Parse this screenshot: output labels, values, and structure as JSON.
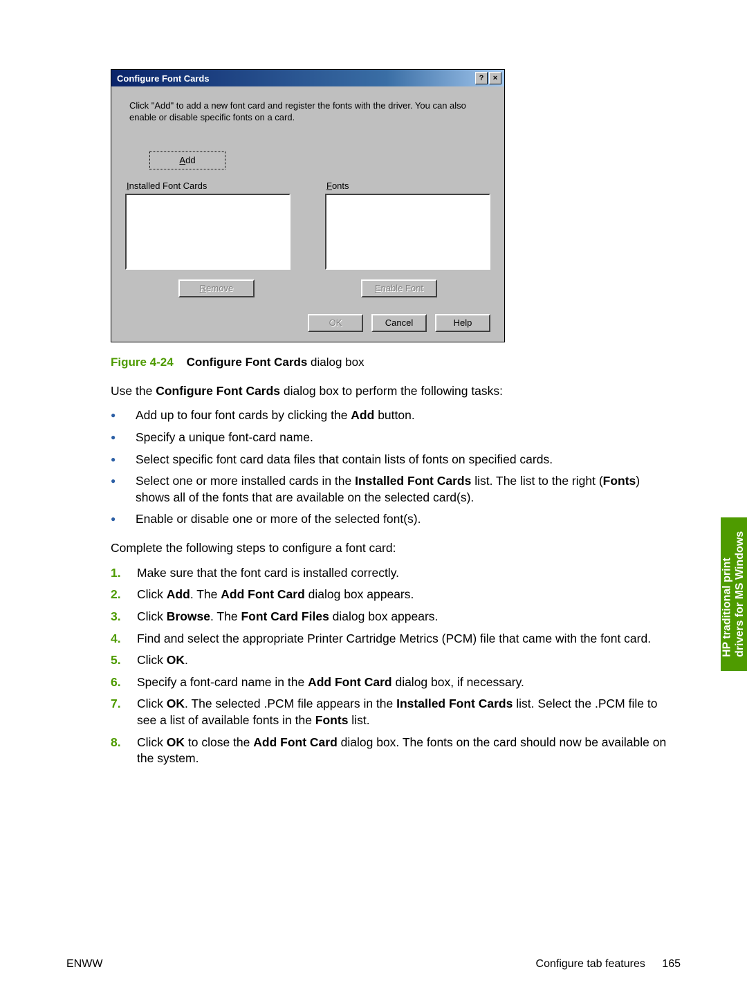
{
  "dialog": {
    "title": "Configure Font Cards",
    "help_icon": "?",
    "close_icon": "×",
    "instruction": "Click \"Add\" to add a new font card and register the fonts with the driver.  You can also enable or disable specific fonts on a card.",
    "add_btn": "Add",
    "installed_label": "Installed Font Cards",
    "fonts_label": "Fonts",
    "remove_btn": "Remove",
    "enable_btn": "Enable Font",
    "ok_btn": "OK",
    "cancel_btn": "Cancel",
    "help_btn": "Help"
  },
  "caption": {
    "fig": "Figure 4-24",
    "strong": "Configure Font Cards",
    "tail": " dialog box"
  },
  "p_intro": {
    "pre": "Use the ",
    "strong": "Configure Font Cards",
    "post": " dialog box to perform the following tasks:"
  },
  "bullets": [
    {
      "pre": "Add up to four font cards by clicking the ",
      "bold": "Add",
      "post": " button."
    },
    {
      "pre": "Specify a unique font-card name.",
      "bold": "",
      "post": ""
    },
    {
      "pre": "Select specific font card data files that contain lists of fonts on specified cards.",
      "bold": "",
      "post": ""
    },
    {
      "pre": "Select one or more installed cards in the ",
      "bold": "Installed Font Cards",
      "post": " list. The list to the right (",
      "bold2": "Fonts",
      "post2": ") shows all of the fonts that are available on the selected card(s)."
    },
    {
      "pre": "Enable or disable one or more of the selected font(s).",
      "bold": "",
      "post": ""
    }
  ],
  "p_steps": "Complete the following steps to configure a font card:",
  "steps": [
    {
      "n": "1.",
      "pre": "Make sure that the font card is installed correctly.",
      "b1": "",
      "mid": "",
      "b2": "",
      "post": ""
    },
    {
      "n": "2.",
      "pre": "Click ",
      "b1": "Add",
      "mid": ". The ",
      "b2": "Add Font Card",
      "post": " dialog box appears."
    },
    {
      "n": "3.",
      "pre": "Click ",
      "b1": "Browse",
      "mid": ". The ",
      "b2": "Font Card Files",
      "post": " dialog box appears."
    },
    {
      "n": "4.",
      "pre": "Find and select the appropriate Printer Cartridge Metrics (PCM) file that came with the font card.",
      "b1": "",
      "mid": "",
      "b2": "",
      "post": ""
    },
    {
      "n": "5.",
      "pre": "Click ",
      "b1": "OK",
      "mid": ".",
      "b2": "",
      "post": ""
    },
    {
      "n": "6.",
      "pre": "Specify a font-card name in the ",
      "b1": "Add Font Card",
      "mid": " dialog box, if necessary.",
      "b2": "",
      "post": ""
    },
    {
      "n": "7.",
      "pre": "Click ",
      "b1": "OK",
      "mid": ". The selected .PCM file appears in the ",
      "b2": "Installed Font Cards",
      "post": " list. Select the .PCM file to see a list of available fonts in the ",
      "b3": "Fonts",
      "post2": "  list."
    },
    {
      "n": "8.",
      "pre": "Click ",
      "b1": "OK",
      "mid": " to close the ",
      "b2": "Add Font Card",
      "post": " dialog box. The fonts on the card should now be available on the system."
    }
  ],
  "side_tab": {
    "l1": "HP traditional print",
    "l2": "drivers for MS Windows"
  },
  "footer": {
    "left": "ENWW",
    "right": "Configure tab features",
    "page": "165"
  }
}
